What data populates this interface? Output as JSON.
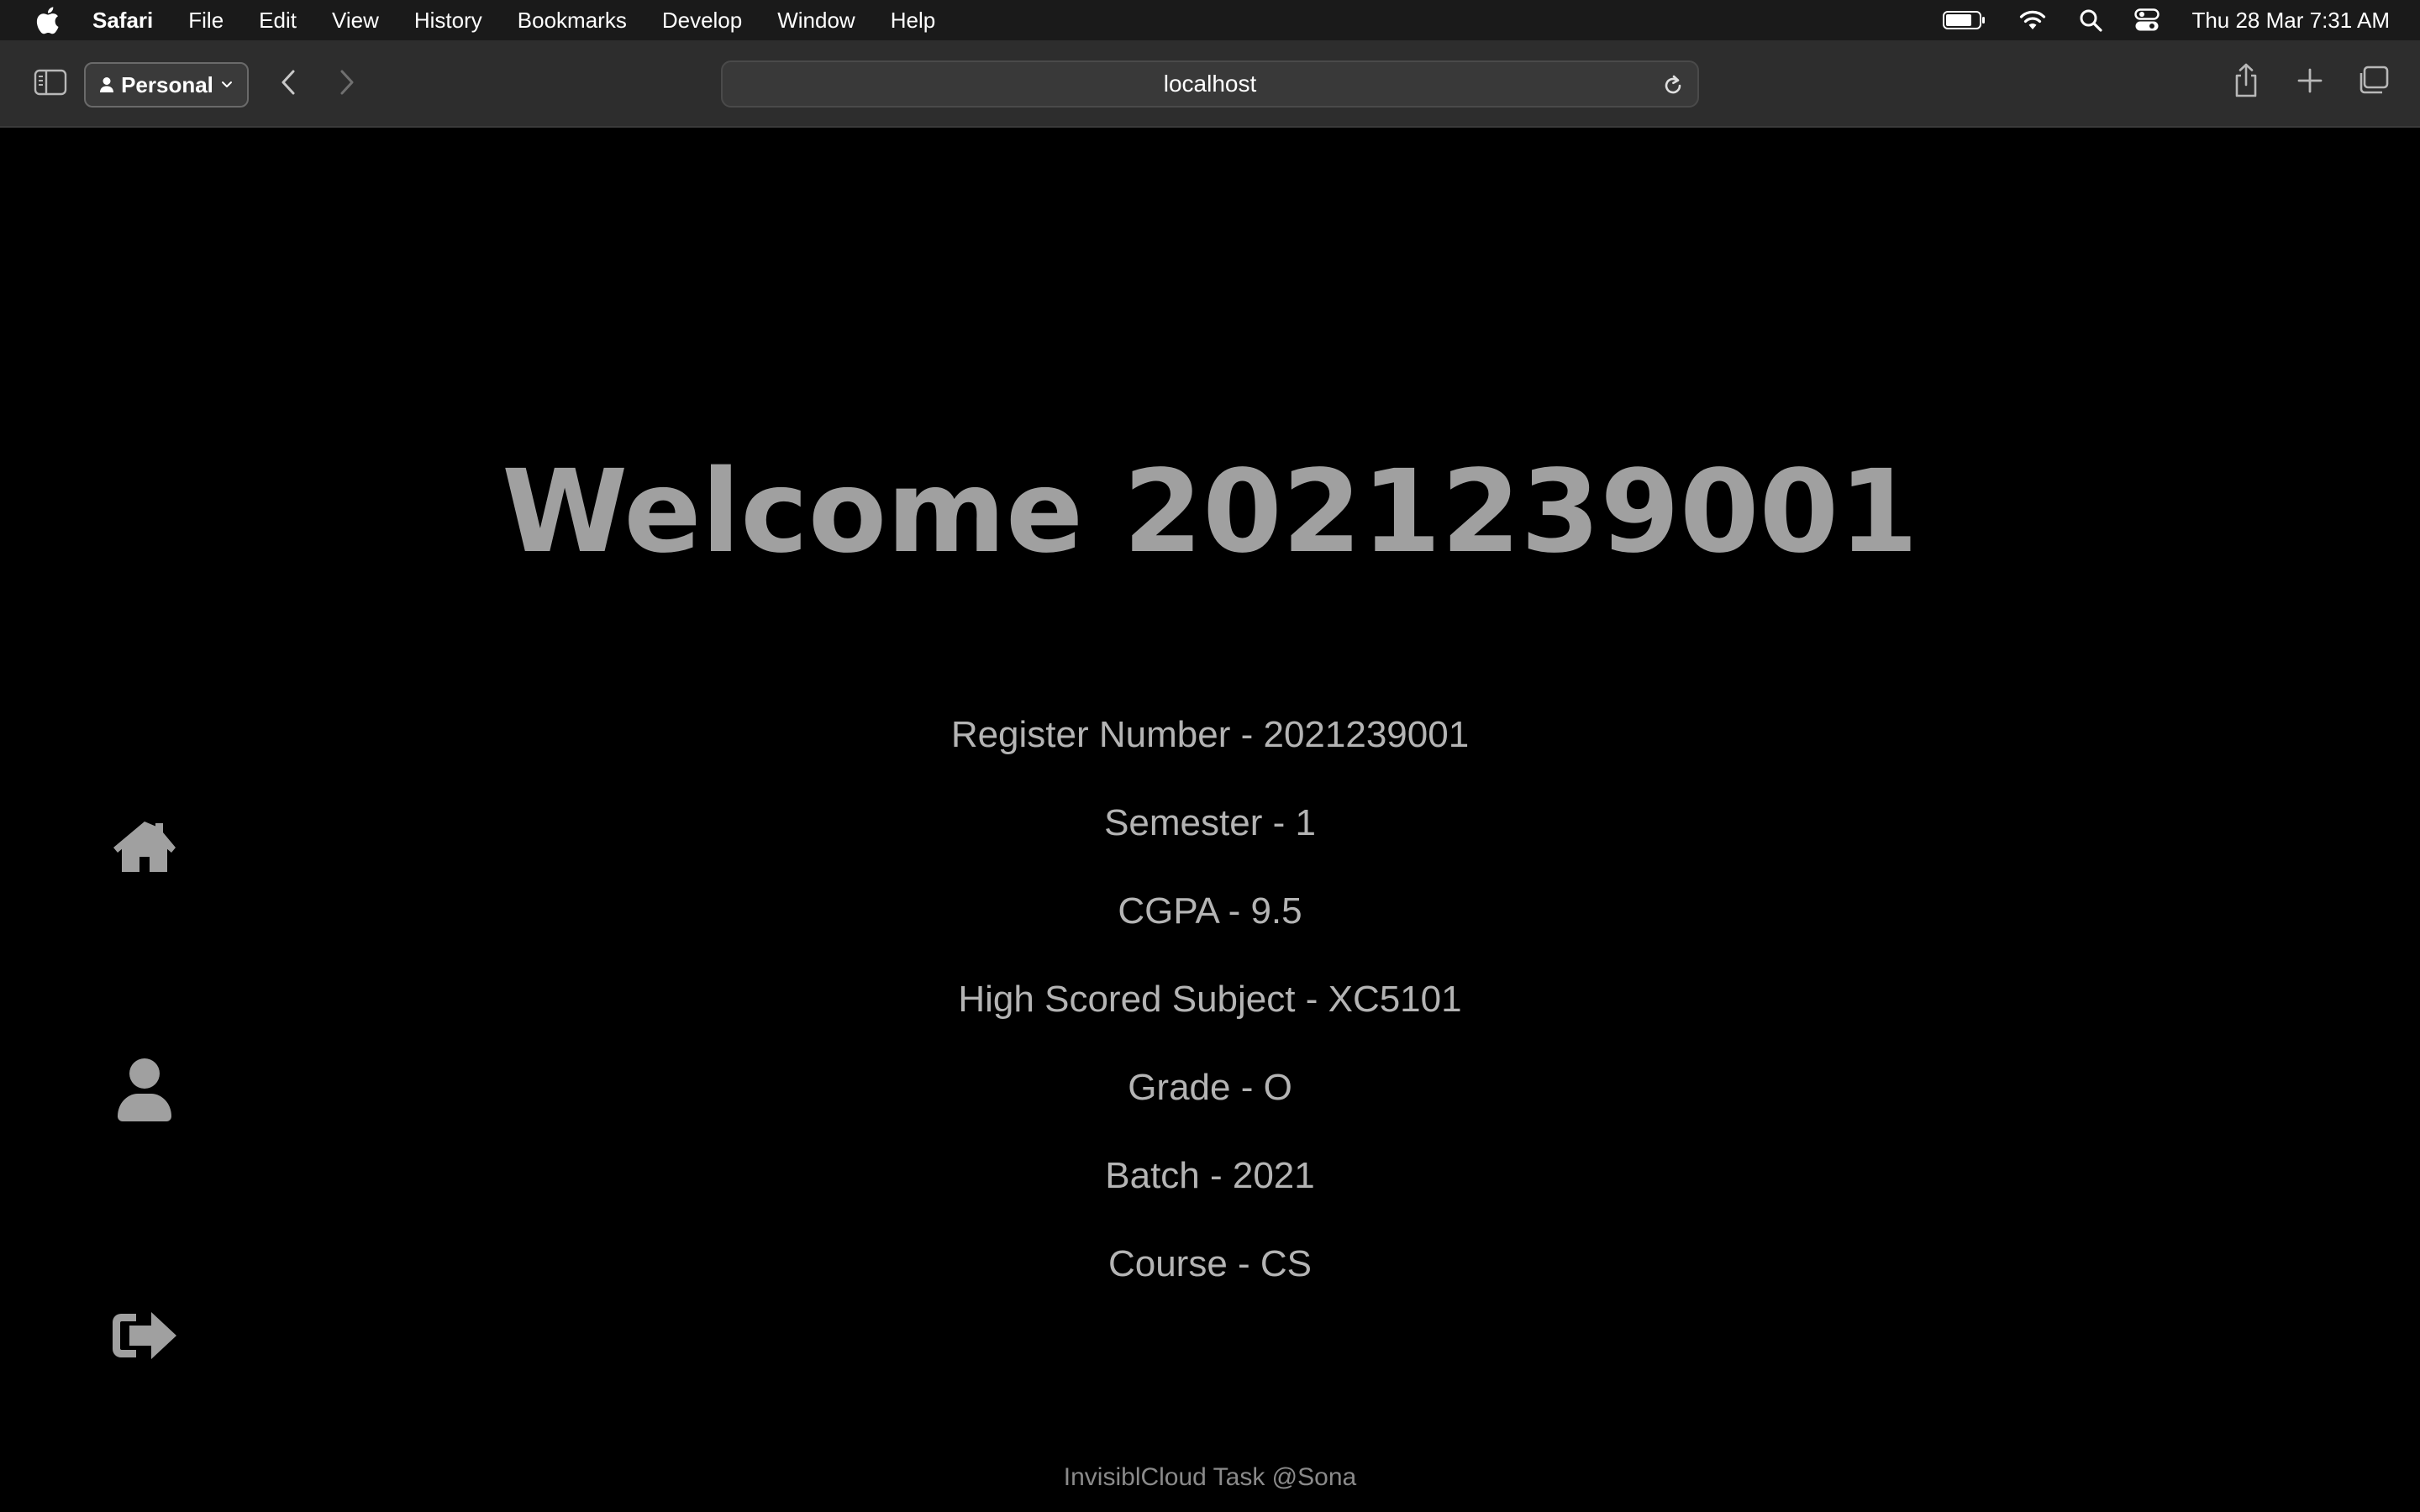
{
  "menubar": {
    "app_name": "Safari",
    "items": [
      "File",
      "Edit",
      "View",
      "History",
      "Bookmarks",
      "Develop",
      "Window",
      "Help"
    ],
    "clock": "Thu 28 Mar  7:31 AM"
  },
  "toolbar": {
    "profile_label": "Personal",
    "address": "localhost"
  },
  "page": {
    "welcome": "Welcome 2021239001",
    "details": [
      "Register Number - 2021239001",
      "Semester - 1",
      "CGPA - 9.5",
      "High Scored Subject - XC5101",
      "Grade - O",
      "Batch - 2021",
      "Course - CS"
    ],
    "footer": "InvisiblCloud Task @Sona"
  },
  "nav": {
    "items": [
      "home-icon",
      "user-icon",
      "sign-out-icon"
    ]
  },
  "colors": {
    "page_background": "#000000",
    "icon_gray": "#a0a0a0",
    "text_gray": "#b4b4b4"
  }
}
